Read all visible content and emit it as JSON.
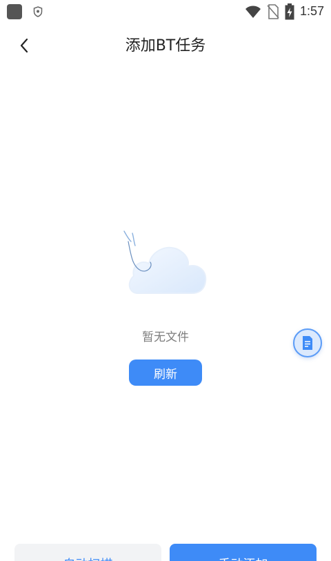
{
  "status_bar": {
    "time": "1:57",
    "icons": [
      "app-icon",
      "shield-icon",
      "wifi-icon",
      "no-sim-icon",
      "battery-charging-icon"
    ]
  },
  "header": {
    "title": "添加BT任务",
    "back_icon": "chevron-left-icon"
  },
  "empty_state": {
    "illustration": "cloud-icon",
    "message": "暂无文件",
    "refresh_label": "刷新"
  },
  "floating": {
    "icon": "document-icon"
  },
  "bottom_actions": {
    "auto_scan_label": "自动扫描",
    "manual_add_label": "手动添加"
  },
  "colors": {
    "accent": "#3e8bf7",
    "secondary_button_bg": "#f2f3f5",
    "muted_text": "#7d7d7d"
  }
}
